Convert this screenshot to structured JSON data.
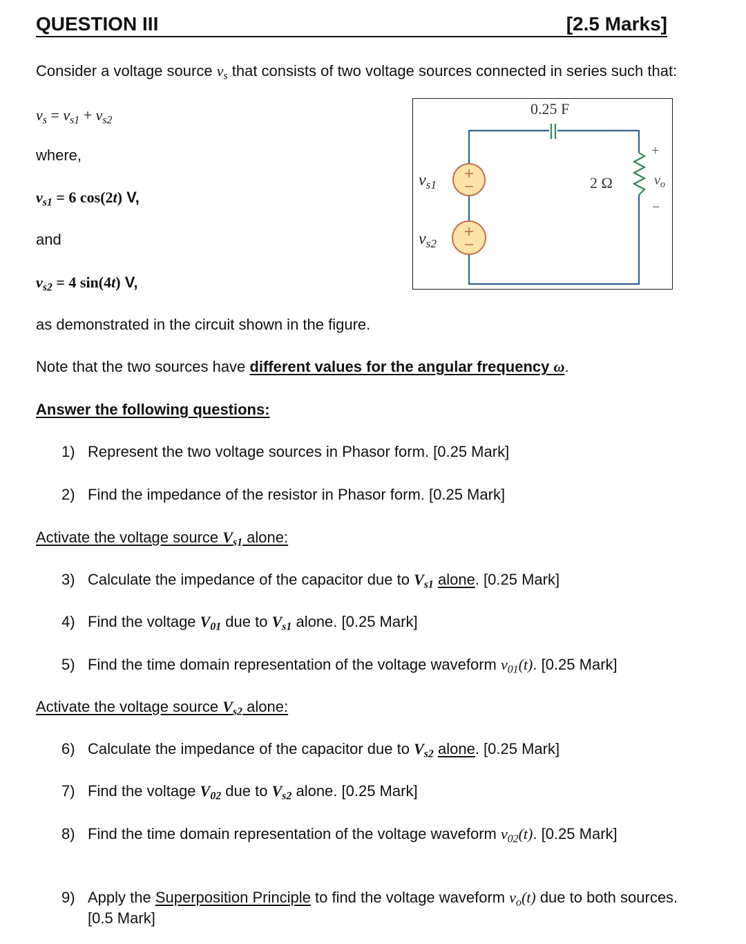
{
  "header": {
    "title": "QUESTION III",
    "marks": "[2.5 Marks]"
  },
  "intro": {
    "sentence_before": "Consider a voltage source ",
    "var_vs": "v",
    "var_vs_sub": "s",
    "sentence_after": " that consists of two voltage sources connected in series such that:"
  },
  "equations": {
    "sum": {
      "lhs": "v",
      "lhs_sub": "s",
      "eq": " = ",
      "t1": "v",
      "t1_sub": "s1",
      "plus": " + ",
      "t2": "v",
      "t2_sub": "s2"
    },
    "where_label": "where,",
    "vs1": {
      "var": "v",
      "sub": "s1",
      "eq": " = 6 cos(2",
      "t": "t",
      "close": ")",
      "unit": " V,"
    },
    "and_label": "and",
    "vs2": {
      "var": "v",
      "sub": "s2",
      "eq": " = 4 sin(4",
      "t": "t",
      "close": ")",
      "unit": " V,"
    }
  },
  "circuit": {
    "capacitor_label": "0.25 F",
    "resistor_label": "2 Ω",
    "source1_label": "v",
    "source1_sub": "s1",
    "source2_label": "v",
    "source2_sub": "s2",
    "output_label": "v",
    "output_sub": "o",
    "plus": "+",
    "minus": "−",
    "colors": {
      "wire": "#2e6291",
      "component": "#2e8a57",
      "source_fill": "#fde3a7",
      "source_stroke": "#c0704a"
    }
  },
  "body": {
    "demonstrated": "as demonstrated in the circuit shown in the figure.",
    "note_before": "Note that the two sources have ",
    "note_bold": "different values for the angular frequency ",
    "note_omega": "ω",
    "note_end": ".",
    "answer_heading": "Answer the following questions:"
  },
  "questions": [
    {
      "num": "1)",
      "text": "Represent the two voltage sources in Phasor form. [0.25 Mark]"
    },
    {
      "num": "2)",
      "text": "Find the impedance of the resistor in Phasor form. [0.25 Mark]"
    }
  ],
  "section1": {
    "heading_before": "Activate the voltage source ",
    "var": "V",
    "sub": "s1",
    "heading_after": " alone:",
    "questions": [
      {
        "num": "3)",
        "before": "Calculate the impedance of the capacitor due to ",
        "var": "V",
        "sub": "s1",
        "space": " ",
        "underlined": "alone",
        "after": ". [0.25 Mark]"
      },
      {
        "num": "4)",
        "before": "Find the voltage ",
        "var1": "V",
        "sub1": "01",
        "mid": " due to ",
        "var2": "V",
        "sub2": "s1",
        "after": " alone. [0.25 Mark]"
      },
      {
        "num": "5)",
        "before": "Find the time domain representation of the voltage waveform ",
        "var": "v",
        "sub": "01",
        "arg": "(t)",
        "after": ". [0.25 Mark]"
      }
    ]
  },
  "section2": {
    "heading_before": "Activate the voltage source ",
    "var": "V",
    "sub": "s2",
    "heading_after": " alone:",
    "questions": [
      {
        "num": "6)",
        "before": "Calculate the impedance of the capacitor due to ",
        "var": "V",
        "sub": "s2",
        "space": " ",
        "underlined": "alone",
        "after": ". [0.25 Mark]"
      },
      {
        "num": "7)",
        "before": "Find the voltage ",
        "var1": "V",
        "sub1": "02",
        "mid": " due to ",
        "var2": "V",
        "sub2": "s2",
        "after": " alone. [0.25 Mark]"
      },
      {
        "num": "8)",
        "before": "Find the time domain representation of the voltage waveform ",
        "var": "v",
        "sub": "02",
        "arg": "(t)",
        "after": ". [0.25 Mark]"
      }
    ]
  },
  "final_question": {
    "num": "9)",
    "before": "Apply the ",
    "underlined": "Superposition Principle",
    "mid": " to find the voltage waveform ",
    "var": "v",
    "sub": "o",
    "arg": "(t)",
    "after": " due to both sources.",
    "marks": "[0.5 Mark]"
  }
}
